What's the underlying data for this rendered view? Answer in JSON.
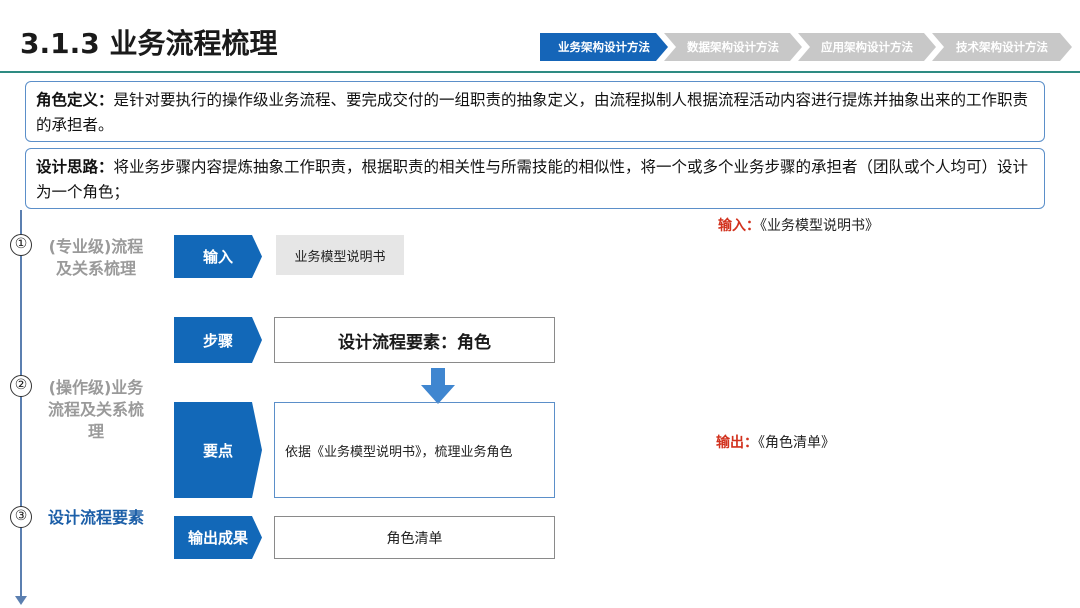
{
  "title": "3.1.3 业务流程梳理",
  "breadcrumbs": [
    {
      "label": "业务架构设计方法",
      "active": true
    },
    {
      "label": "数据架构设计方法",
      "active": false
    },
    {
      "label": "应用架构设计方法",
      "active": false
    },
    {
      "label": "技术架构设计方法",
      "active": false
    }
  ],
  "definition": {
    "label": "角色定义：",
    "text": "是针对要执行的操作级业务流程、要完成交付的一组职责的抽象定义，由流程拟制人根据流程活动内容进行提炼并抽象出来的工作职责的承担者。"
  },
  "approach": {
    "label": "设计思路：",
    "text": "将业务步骤内容提炼抽象工作职责，根据职责的相关性与所需技能的相似性，将一个或多个业务步骤的承担者（团队或个人均可）设计为一个角色；"
  },
  "phases": [
    {
      "num": "①",
      "label": "(专业级)流程及关系梳理"
    },
    {
      "num": "②",
      "label": "(操作级)业务流程及关系梳理"
    },
    {
      "num": "③",
      "label": "设计流程要素"
    }
  ],
  "rows": {
    "input": {
      "tag": "输入",
      "content": "业务模型说明书"
    },
    "step": {
      "tag": "步骤",
      "content": "设计流程要素：角色"
    },
    "key": {
      "tag": "要点",
      "content": "依据《业务模型说明书》，梳理业务角色"
    },
    "output": {
      "tag": "输出成果",
      "content": "角色清单"
    }
  },
  "side": {
    "input_label": "输入：",
    "input_value": "《业务模型说明书》",
    "output_label": "输出：",
    "output_value": "《角色清单》"
  },
  "colors": {
    "accent": "#1268b8",
    "rule": "#2e8b82",
    "highlight": "#d2321e"
  }
}
